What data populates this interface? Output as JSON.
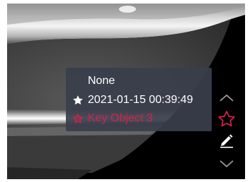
{
  "key_object_menu": {
    "items": [
      {
        "label": "None",
        "icon": "none"
      },
      {
        "label": "2021-01-15 00:39:49",
        "icon": "star-filled-icon"
      },
      {
        "label": "Key Object 3",
        "icon": "star-outline-icon",
        "selected": true
      }
    ]
  },
  "toolbar": {
    "icons": [
      "chevron-up-icon",
      "star-outline-icon",
      "pencil-icon",
      "chevron-down-icon"
    ],
    "active_color": "#d8204a",
    "icon_color": "#ffffff"
  },
  "colors": {
    "popup_background": "#3a3e4c",
    "accent": "#d8204a"
  }
}
